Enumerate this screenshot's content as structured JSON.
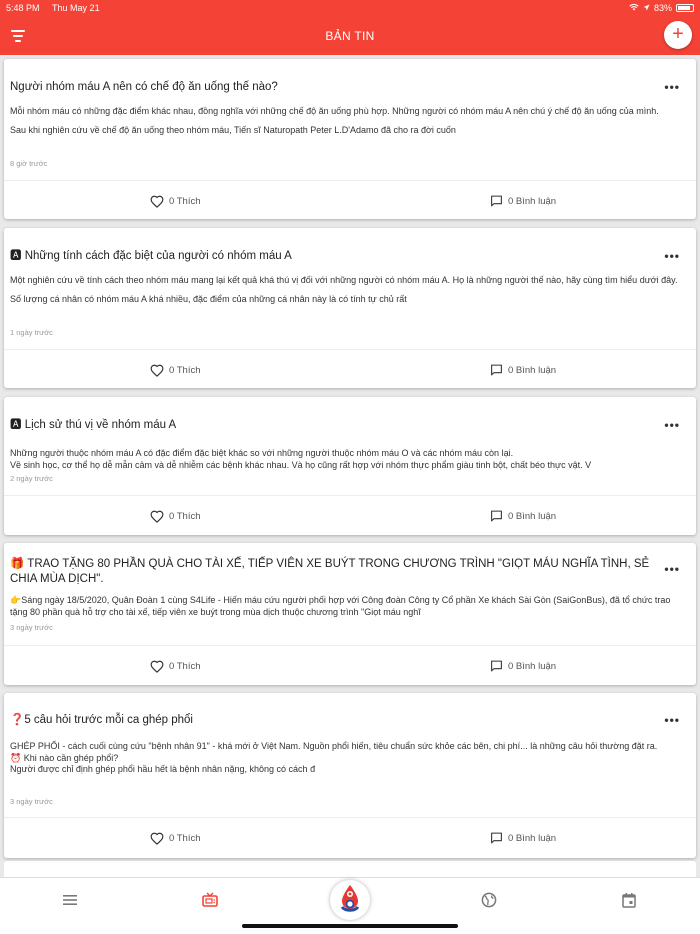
{
  "status_bar": {
    "time": "5:48 PM",
    "date": "Thu May 21",
    "battery": "83%"
  },
  "header": {
    "title": "BẢN TIN",
    "add_label": "+"
  },
  "posts": [
    {
      "title": "Người nhóm máu A nên có chế độ ăn uống thế nào?",
      "body": [
        "Mỗi nhóm máu có những đặc điểm khác nhau, đồng nghĩa với những chế độ ăn uống phù hợp. Những người có nhóm máu A nên chú ý chế độ ăn uống của mình.",
        "Sau khi nghiên cứu về chế độ ăn uống theo nhóm máu, Tiến sĩ Naturopath Peter L.D'Adamo đã cho ra đời cuốn"
      ],
      "time": "8 giờ trước",
      "likes": "0 Thích",
      "comments": "0 Bình luận"
    },
    {
      "title": "🅰 Những tính cách đặc biệt của người có nhóm máu A",
      "body": [
        "Một nghiên cứu về tính cách theo nhóm máu mang lại kết quả khá thú vị đối với những người có nhóm máu A. Họ là những người thế nào, hãy cùng tìm hiểu dưới đây.",
        "Số lượng cá nhân có nhóm máu A khá nhiều, đặc điểm của những cá nhân này là có tính tự chủ rất"
      ],
      "time": "1 ngày trước",
      "likes": "0 Thích",
      "comments": "0 Bình luận"
    },
    {
      "title": "🅰 Lịch sử thú vị về nhóm máu A",
      "body": [
        "Những người thuộc nhóm máu A có đặc điểm đặc biệt khác so với những người thuộc nhóm máu O và các nhóm máu còn lại.",
        "Về sinh học, cơ thể họ dễ mẫn cảm và dễ nhiễm các bệnh khác nhau. Và họ cũng rất hợp với nhóm thực phẩm giàu tinh bột, chất béo thực vật. V"
      ],
      "time": "2 ngày trước",
      "likes": "0 Thích",
      "comments": "0 Bình luận"
    },
    {
      "title": "🎁 TRAO TẶNG 80 PHẦN QUÀ CHO TÀI XẾ, TIẾP VIÊN XE BUÝT TRONG CHƯƠNG TRÌNH \"GIỌT MÁU NGHĨA TÌNH, SẺ CHIA MÙA DỊCH\".",
      "body": [
        "👉Sáng ngày 18/5/2020, Quân Đoàn 1 cùng S4Life - Hiến máu cứu người phối hợp với Công đoàn Công ty Cổ phần Xe khách Sài Gòn (SaiGonBus), đã tổ chức trao tặng 80 phần quà hỗ trợ cho tài xế, tiếp viên xe buýt trong mùa dịch thuộc chương trình \"Giọt máu nghĩ"
      ],
      "time": "3 ngày trước",
      "likes": "0 Thích",
      "comments": "0 Bình luận"
    },
    {
      "title": "❓5 câu hỏi trước mỗi ca ghép phổi",
      "body": [
        "GHÉP PHỔI - cách cuối cùng cứu \"bệnh nhân 91\" - khá mới ở Việt Nam. Nguồn phổi hiến, tiêu chuẩn sức khỏe các bên, chi phí... là những câu hỏi thường đặt ra.",
        "⏰ Khi nào cần ghép phổi?",
        "Người được chỉ định ghép phổi hầu hết là bệnh nhân nặng, không có cách đ"
      ],
      "time": "3 ngày trước",
      "likes": "0 Thích",
      "comments": "0 Bình luận"
    }
  ],
  "icons": {
    "filter": "filter-icon",
    "add": "plus-icon",
    "more": "more-icon",
    "like": "heart-icon",
    "comment": "comment-icon",
    "tab_menu": "menu-icon",
    "tab_news": "tv-icon",
    "tab_center": "blood-drop-logo",
    "tab_globe": "globe-icon",
    "tab_calendar": "calendar-icon"
  },
  "colors": {
    "primary": "#f44336",
    "active_tab": "#f44336",
    "inactive_tab": "#777777"
  }
}
